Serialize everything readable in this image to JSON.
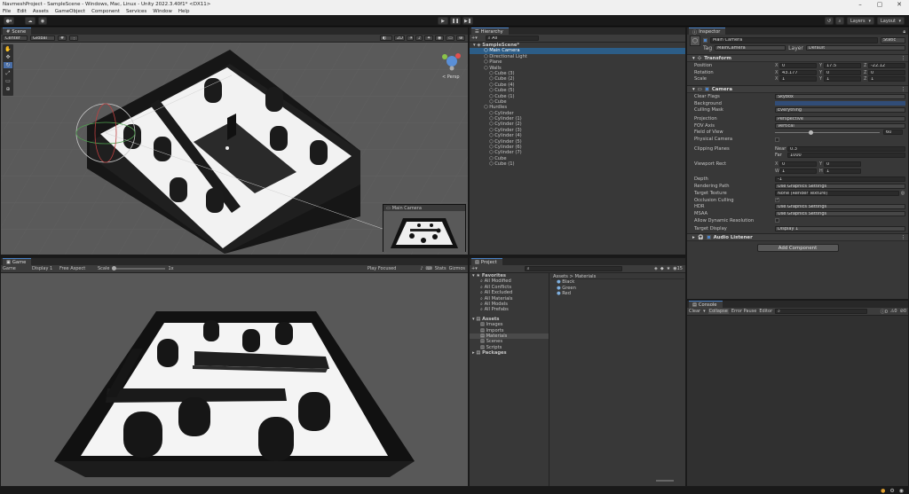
{
  "window": {
    "title": "NavmeshProject - SampleScene - Windows, Mac, Linux - Unity 2022.3.40f1* <DX11>"
  },
  "menu": [
    "File",
    "Edit",
    "Assets",
    "GameObject",
    "Component",
    "Services",
    "Window",
    "Help"
  ],
  "toolbar": {
    "layers": "Layers",
    "layout": "Layout"
  },
  "scene": {
    "tab": "Scene",
    "pivot": "Center",
    "space": "Global",
    "mode_2d": "2D",
    "persp_label": "< Persp",
    "preview_title": "Main Camera"
  },
  "game": {
    "tab": "Game",
    "mode": "Game",
    "display": "Display 1",
    "aspect": "Free Aspect",
    "scale_label": "Scale",
    "scale_value": "1x",
    "play_focused": "Play Focused",
    "stats": "Stats",
    "gizmos": "Gizmos"
  },
  "hierarchy": {
    "tab": "Hierarchy",
    "search_placeholder": "All",
    "items": [
      {
        "name": "SampleScene*",
        "indent": 0,
        "selected": false,
        "bold": true
      },
      {
        "name": "Main Camera",
        "indent": 2,
        "selected": true,
        "bold": false
      },
      {
        "name": "Directional Light",
        "indent": 2,
        "selected": false,
        "bold": false
      },
      {
        "name": "Plane",
        "indent": 2,
        "selected": false,
        "bold": false
      },
      {
        "name": "Walls",
        "indent": 2,
        "selected": false,
        "bold": false
      },
      {
        "name": "Cube (3)",
        "indent": 3,
        "selected": false,
        "bold": false
      },
      {
        "name": "Cube (2)",
        "indent": 3,
        "selected": false,
        "bold": false
      },
      {
        "name": "Cube (4)",
        "indent": 3,
        "selected": false,
        "bold": false
      },
      {
        "name": "Cube (5)",
        "indent": 3,
        "selected": false,
        "bold": false
      },
      {
        "name": "Cube (1)",
        "indent": 3,
        "selected": false,
        "bold": false
      },
      {
        "name": "Cube",
        "indent": 3,
        "selected": false,
        "bold": false
      },
      {
        "name": "Hurdles",
        "indent": 2,
        "selected": false,
        "bold": false
      },
      {
        "name": "Cylinder",
        "indent": 3,
        "selected": false,
        "bold": false
      },
      {
        "name": "Cylinder (1)",
        "indent": 3,
        "selected": false,
        "bold": false
      },
      {
        "name": "Cylinder (2)",
        "indent": 3,
        "selected": false,
        "bold": false
      },
      {
        "name": "Cylinder (3)",
        "indent": 3,
        "selected": false,
        "bold": false
      },
      {
        "name": "Cylinder (4)",
        "indent": 3,
        "selected": false,
        "bold": false
      },
      {
        "name": "Cylinder (5)",
        "indent": 3,
        "selected": false,
        "bold": false
      },
      {
        "name": "Cylinder (6)",
        "indent": 3,
        "selected": false,
        "bold": false
      },
      {
        "name": "Cylinder (7)",
        "indent": 3,
        "selected": false,
        "bold": false
      },
      {
        "name": "Cube",
        "indent": 3,
        "selected": false,
        "bold": false
      },
      {
        "name": "Cube (1)",
        "indent": 3,
        "selected": false,
        "bold": false
      }
    ]
  },
  "project": {
    "tab": "Project",
    "count_badge": "15",
    "favorites_header": "Favorites",
    "favorites": [
      "All Modified",
      "All Conflicts",
      "All Excluded",
      "All Materials",
      "All Models",
      "All Prefabs"
    ],
    "assets_header": "Assets",
    "asset_folders": [
      "Images",
      "Imports",
      "Materials",
      "Scenes",
      "Scripts"
    ],
    "packages_header": "Packages",
    "breadcrumb": "Assets > Materials",
    "files": [
      "Black",
      "Green",
      "Red"
    ]
  },
  "inspector": {
    "tab": "Inspector",
    "object_name": "Main Camera",
    "static_label": "Static",
    "tag_label": "Tag",
    "tag_value": "MainCamera",
    "layer_label": "Layer",
    "layer_value": "Default",
    "transform": {
      "header": "Transform",
      "position": {
        "label": "Position",
        "x": "0",
        "y": "17.5",
        "z": "-22.12"
      },
      "rotation": {
        "label": "Rotation",
        "x": "43.177",
        "y": "0",
        "z": "0"
      },
      "scale": {
        "label": "Scale",
        "x": "1",
        "y": "1",
        "z": "1"
      }
    },
    "camera": {
      "header": "Camera",
      "clear_flags": {
        "label": "Clear Flags",
        "value": "Skybox"
      },
      "background": {
        "label": "Background"
      },
      "culling_mask": {
        "label": "Culling Mask",
        "value": "Everything"
      },
      "projection": {
        "label": "Projection",
        "value": "Perspective"
      },
      "fov_axis": {
        "label": "FOV Axis",
        "value": "Vertical"
      },
      "field_of_view": {
        "label": "Field of View",
        "value": "60"
      },
      "physical_camera": {
        "label": "Physical Camera"
      },
      "clipping_planes": {
        "label": "Clipping Planes",
        "near_label": "Near",
        "near": "0.3",
        "far_label": "Far",
        "far": "1000"
      },
      "viewport_rect": {
        "label": "Viewport Rect",
        "x": "0",
        "y": "0",
        "w": "1",
        "h": "1"
      },
      "depth": {
        "label": "Depth",
        "value": "-1"
      },
      "rendering_path": {
        "label": "Rendering Path",
        "value": "Use Graphics Settings"
      },
      "target_texture": {
        "label": "Target Texture",
        "value": "None (Render Texture)"
      },
      "occlusion_culling": {
        "label": "Occlusion Culling"
      },
      "hdr": {
        "label": "HDR",
        "value": "Use Graphics Settings"
      },
      "msaa": {
        "label": "MSAA",
        "value": "Use Graphics Settings"
      },
      "allow_dynamic_resolution": {
        "label": "Allow Dynamic Resolution"
      },
      "target_display": {
        "label": "Target Display",
        "value": "Display 1"
      }
    },
    "audio_listener": {
      "header": "Audio Listener"
    },
    "add_component": "Add Component"
  },
  "console": {
    "tab": "Console",
    "clear": "Clear",
    "collapse": "Collapse",
    "error_pause": "Error Pause",
    "editor": "Editor",
    "counts": [
      "0",
      "0",
      "0"
    ]
  },
  "colors": {
    "selection": "#2c5d87",
    "accent": "#4a82c8",
    "background_swatch": "#314d78",
    "editor_bg": "#383838"
  }
}
